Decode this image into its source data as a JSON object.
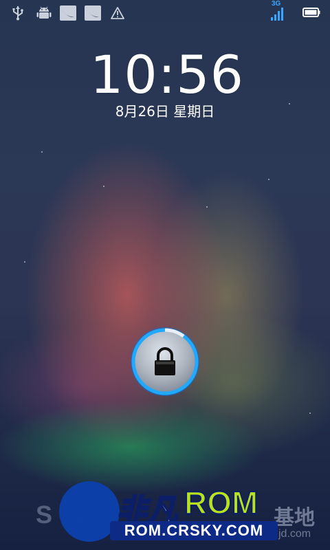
{
  "status_bar": {
    "icons": [
      "usb-icon",
      "android-debug-icon",
      "app-notification-icon",
      "app-notification-icon",
      "warning-icon",
      "signal-icon",
      "battery-icon"
    ],
    "network_type": "3G",
    "accent_color": "#3aa6ff"
  },
  "lockscreen": {
    "time": "10:56",
    "date": "8月26日 星期日",
    "lock_icon": "padlock-icon",
    "ring_color": "#21a8ff"
  },
  "watermark": {
    "brand_cn": "非凡",
    "brand_rom": "ROM",
    "url": "ROM.CRSKY.COM",
    "ghost_left": "S",
    "ghost_right": "基地",
    "ghost_url": "jd.com"
  }
}
